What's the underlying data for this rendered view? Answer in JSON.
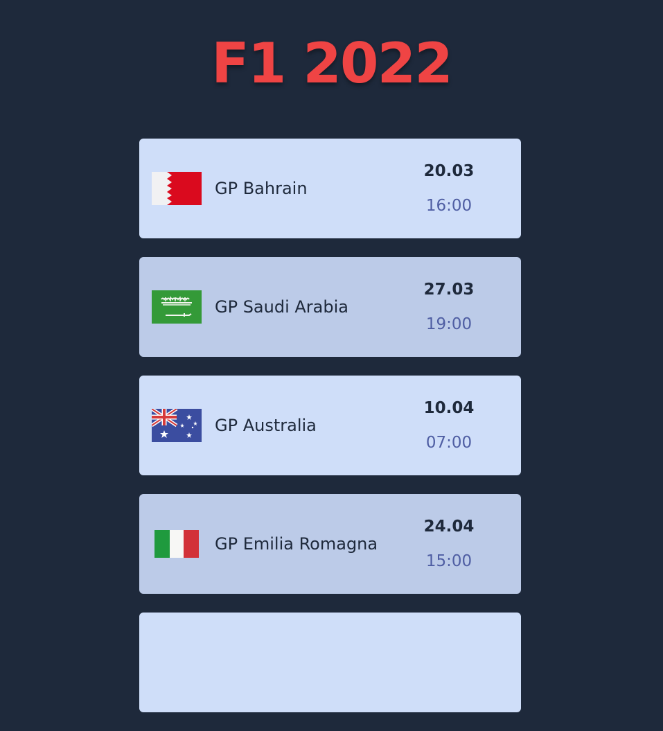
{
  "header": {
    "title": "F1 2022"
  },
  "races": [
    {
      "name": "GP Bahrain",
      "date": "20.03",
      "time": "16:00",
      "flag": "bahrain-flag-icon"
    },
    {
      "name": "GP Saudi Arabia",
      "date": "27.03",
      "time": "19:00",
      "flag": "saudi-arabia-flag-icon"
    },
    {
      "name": "GP Australia",
      "date": "10.04",
      "time": "07:00",
      "flag": "australia-flag-icon"
    },
    {
      "name": "GP Emilia Romagna",
      "date": "24.04",
      "time": "15:00",
      "flag": "italy-flag-icon"
    },
    {
      "name": "",
      "date": "",
      "time": "",
      "flag": ""
    }
  ],
  "colors": {
    "background": "#1e293b",
    "title": "#ef4444",
    "card_light": "#cfdef9",
    "card_dark": "#bccbe8",
    "time_text": "#4f5ea3"
  }
}
